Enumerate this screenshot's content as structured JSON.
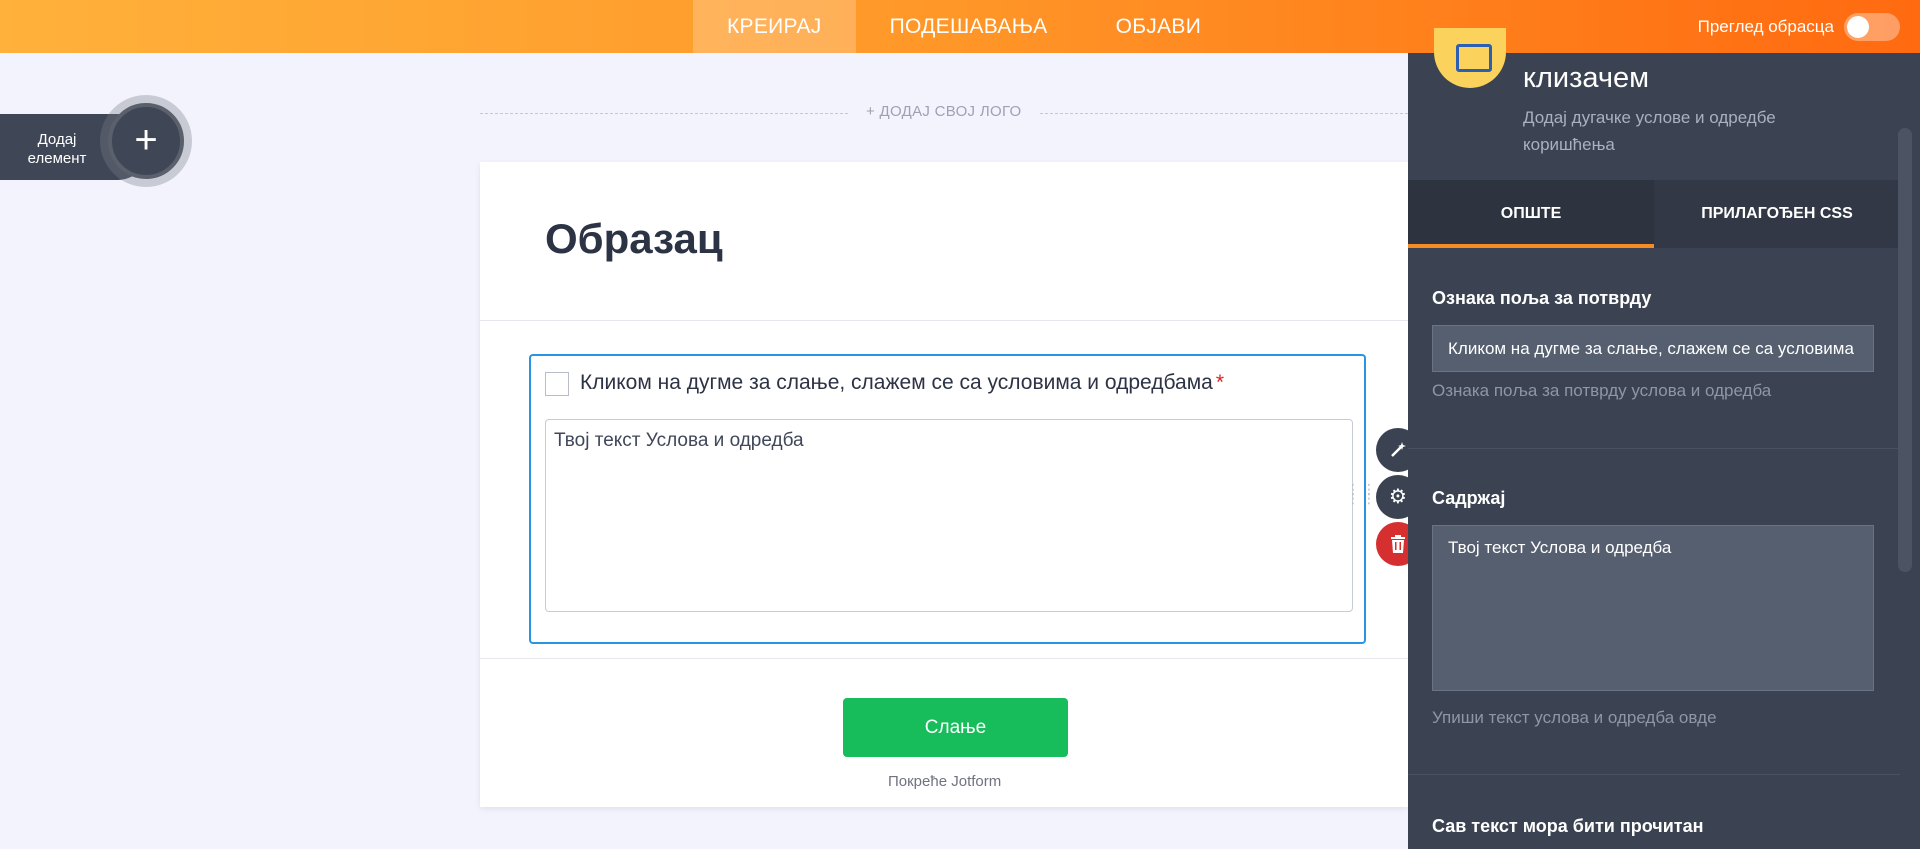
{
  "topbar": {
    "tabs": [
      {
        "label": "КРЕИРАЈ",
        "active": true
      },
      {
        "label": "ПОДЕШАВАЊА",
        "active": false
      },
      {
        "label": "ОБЈАВИ",
        "active": false
      }
    ],
    "preview_label": "Преглед обрасца",
    "colors": {
      "gradient_start": "#ffb13b",
      "gradient_end": "#ff6a10"
    }
  },
  "add_element": {
    "label_line1": "Додај",
    "label_line2": "елемент",
    "icon": "plus-icon"
  },
  "logo": {
    "label": "+ ДОДАЈ СВОЈ ЛОГО"
  },
  "form": {
    "title": "Образац",
    "checkbox_label": "Кликом на дугме за слање, слажем се са условима и одредбама",
    "required_mark": "*",
    "terms_text": "Твој текст Услова и одредба",
    "submit_label": "Слање",
    "powered_by": "Покреће Jotform"
  },
  "field_tools": [
    {
      "name": "wand-icon",
      "symbol": "✦"
    },
    {
      "name": "gear-icon",
      "symbol": "⚙"
    },
    {
      "name": "trash-icon",
      "symbol": "🗑"
    }
  ],
  "panel": {
    "title": "клизачем",
    "description": "Додај дугачке услове и одредбе коришћења",
    "tabs": [
      {
        "label": "ОПШТЕ",
        "active": true
      },
      {
        "label": "ПРИЛАГОЂЕН CSS",
        "active": false
      }
    ],
    "confirm_label": "Ознака поља за потврду",
    "confirm_value": "Кликом на дугме за слање, слажем се са условима",
    "confirm_help": "Ознака поља за потврду услова и одредба",
    "content_label": "Садржај",
    "content_value": "Твој текст Услова и одредба",
    "content_help": "Упиши текст услова и одредба овде",
    "must_read_label": "Сав текст мора бити прочитан"
  },
  "accent_colors": {
    "blue_border": "#2b94e0",
    "submit_green": "#18bd5b",
    "delete_red": "#d62f2f",
    "tab_orange": "#f68a26"
  }
}
